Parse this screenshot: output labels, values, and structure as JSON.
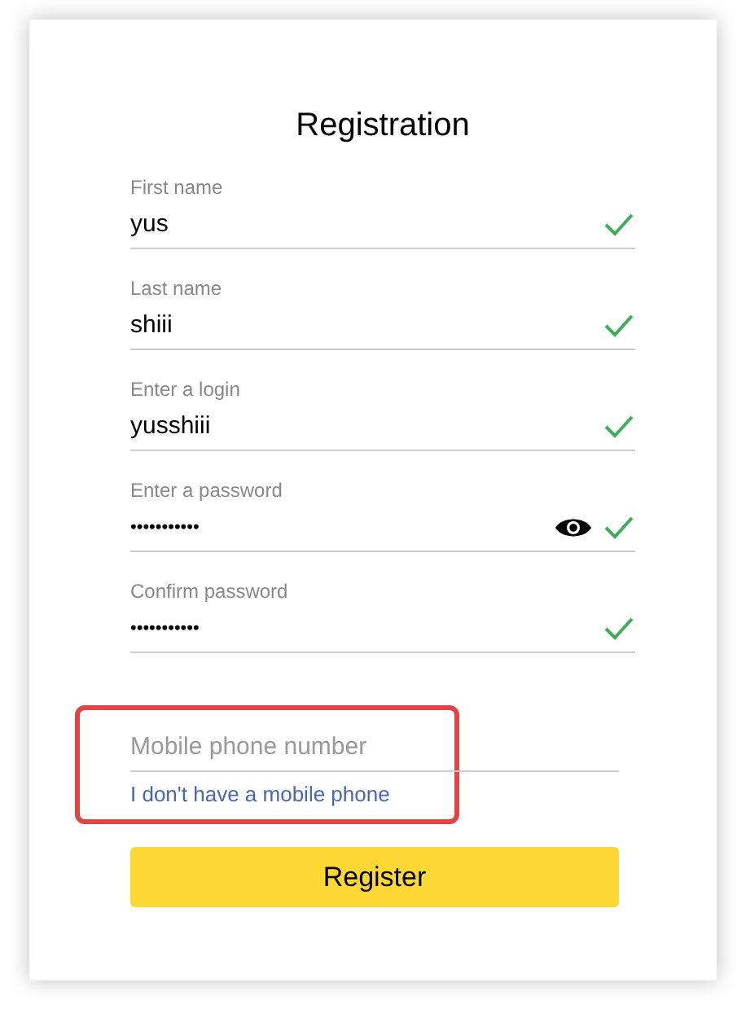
{
  "title": "Registration",
  "fields": [
    {
      "label": "First name",
      "value": "yus",
      "kind": "text",
      "valid": true
    },
    {
      "label": "Last name",
      "value": "shiii",
      "kind": "text",
      "valid": true
    },
    {
      "label": "Enter a login",
      "value": "yusshiii",
      "kind": "text",
      "valid": true
    },
    {
      "label": "Enter a password",
      "value": "•••••••••••",
      "kind": "password",
      "valid": true
    },
    {
      "label": "Confirm password",
      "value": "•••••••••••",
      "kind": "text",
      "valid": true
    }
  ],
  "phone": {
    "placeholder": "Mobile phone number",
    "link": "I don't have a mobile phone",
    "highlighted": true
  },
  "submit_button": "Register"
}
